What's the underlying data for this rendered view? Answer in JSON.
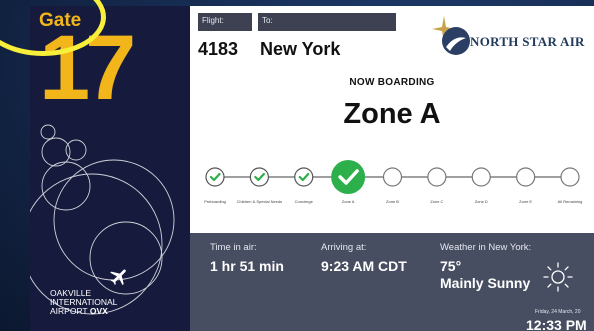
{
  "gate": {
    "label": "Gate",
    "number": "17"
  },
  "airport": {
    "line1": "Oakville",
    "line2": "International",
    "line3_prefix": "Airport",
    "code": "OVX"
  },
  "flight": {
    "flight_label": "Flight:",
    "to_label": "To:",
    "number": "4183",
    "destination": "New York"
  },
  "airline": {
    "name": "North Star Air"
  },
  "boarding": {
    "status": "NOW BOARDING",
    "zone": "Zone A",
    "current_stage_index": 3,
    "stages": [
      {
        "label": "Preboarding",
        "state": "done"
      },
      {
        "label": "Children & Special Needs",
        "state": "done"
      },
      {
        "label": "Concierge",
        "state": "done"
      },
      {
        "label": "Zone A",
        "state": "current"
      },
      {
        "label": "Zone B",
        "state": "pending"
      },
      {
        "label": "Zone C",
        "state": "pending"
      },
      {
        "label": "Zone D",
        "state": "pending"
      },
      {
        "label": "Zone E",
        "state": "pending"
      },
      {
        "label": "All Remaining",
        "state": "pending"
      }
    ]
  },
  "info": {
    "time_in_air_label": "Time in air:",
    "time_in_air": "1 hr 51 min",
    "arriving_label": "Arriving at:",
    "arriving": "9:23 AM CDT",
    "weather_label": "Weather in New York:",
    "temperature": "75°",
    "conditions": "Mainly Sunny",
    "weather_icon": "sun-icon",
    "date": "Friday, 24 March, 20",
    "time": "12:33 PM"
  },
  "colors": {
    "gate_accent": "#f2b51a",
    "progress_green": "#2db04b",
    "panel_dark": "#474e61",
    "left_panel": "#161b3d",
    "highlight": "#f7ef3a"
  }
}
